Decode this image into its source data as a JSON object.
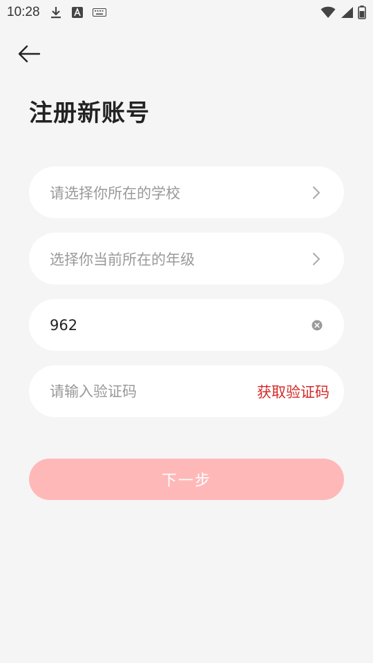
{
  "status_bar": {
    "time": "10:28",
    "icons": [
      "download-icon",
      "font-a-icon",
      "keyboard-icon",
      "wifi-icon",
      "signal-icon",
      "battery-icon"
    ]
  },
  "header": {
    "back_icon": "arrow-left-icon",
    "title": "注册新账号"
  },
  "form": {
    "school": {
      "placeholder": "请选择你所在的学校",
      "icon": "chevron-right-icon"
    },
    "grade": {
      "placeholder": "选择你当前所在的年级",
      "icon": "chevron-right-icon"
    },
    "phone": {
      "value": "962",
      "icon": "clear-icon"
    },
    "code": {
      "placeholder": "请输入验证码",
      "get_code_label": "获取验证码"
    }
  },
  "next_button": {
    "label": "下一步"
  },
  "colors": {
    "background": "#f5f5f5",
    "field_background": "#ffffff",
    "accent": "#d42a2a",
    "button_disabled": "#ffb8b8"
  }
}
